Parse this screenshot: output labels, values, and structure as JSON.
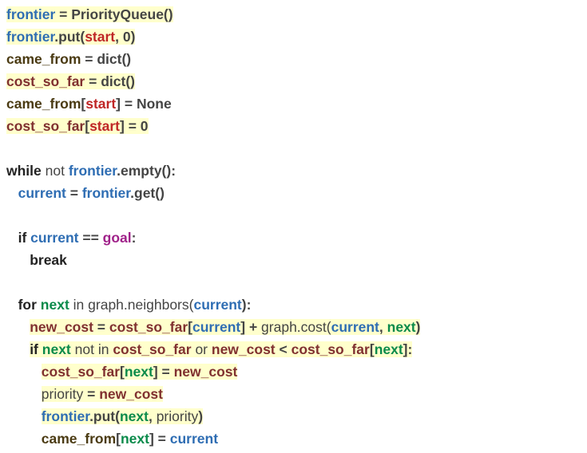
{
  "tokens": {
    "frontier": "frontier",
    "PriorityQueue": "PriorityQueue()",
    "put": ".put(",
    "start": "start",
    "zero": "0",
    "came_from": "came_from",
    "cost_so_far": "cost_so_far",
    "dict": "dict()",
    "None": "None",
    "while": "while",
    "not": "not",
    "empty": ".empty():",
    "current": "current",
    "get": ".get()",
    "if": "if",
    "goal": "goal",
    "break": "break",
    "for": "for",
    "next": "next",
    "in": "in",
    "graph_neighbors": "graph.neighbors(",
    "graph_cost": "graph.cost(",
    "new_cost": "new_cost",
    "not_in": "not in",
    "or": "or",
    "lt": "<",
    "priority": "priority",
    "eq": "=",
    "eqeq": "==",
    "colon": ":",
    "comma": ",",
    "cparen": ")",
    "obrack": "[",
    "cbrack": "]",
    "plus": "+"
  }
}
